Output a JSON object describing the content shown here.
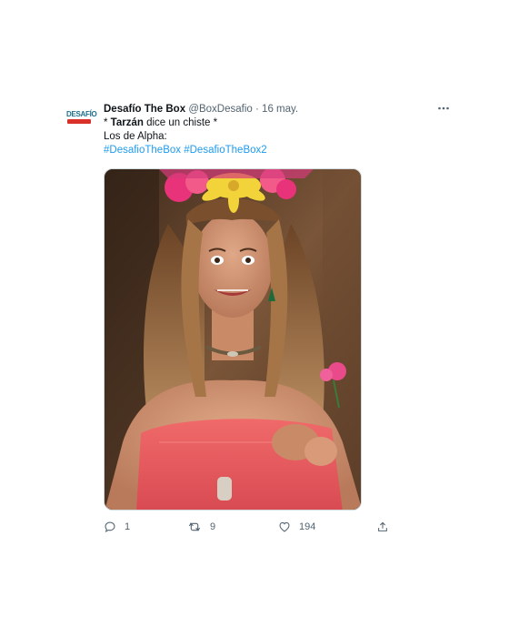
{
  "account": {
    "avatar_text": "DESAFÍO",
    "display_name": "Desafío The Box",
    "handle": "@BoxDesafio",
    "separator": "·",
    "date": "16 may."
  },
  "more_icon": "more-horizontal-icon",
  "tweet": {
    "line1_prefix": "* ",
    "line1_bold": "Tarzán",
    "line1_rest": " dice un chiste *",
    "line2": "Los de Alpha:",
    "hashtag1": "#DesafioTheBox",
    "hashtag2": "#DesafioTheBox2"
  },
  "media": {
    "kind": "photo",
    "subject": "reaction photo"
  },
  "actions": {
    "reply": {
      "icon": "reply-icon",
      "count": "1"
    },
    "retweet": {
      "icon": "retweet-icon",
      "count": "9"
    },
    "like": {
      "icon": "heart-icon",
      "count": "194"
    },
    "share": {
      "icon": "share-icon"
    }
  },
  "colors": {
    "text": "#0f1419",
    "secondary": "#536471",
    "link": "#1d9bf0",
    "border": "#cfd9de"
  }
}
